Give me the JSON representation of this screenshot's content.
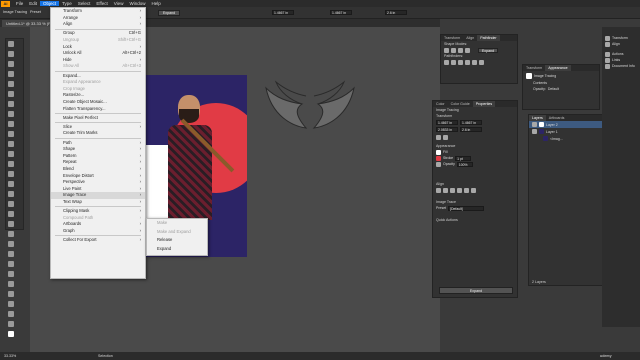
{
  "menubar": {
    "logo": "Ai",
    "items": [
      "File",
      "Edit",
      "Object",
      "Type",
      "Select",
      "Effect",
      "View",
      "Window",
      "Help"
    ],
    "active_index": 2
  },
  "control_bar": {
    "left_label": "Image Tracing",
    "preset": "Preset",
    "expand_button": "Expand"
  },
  "document_tab": {
    "title": "Untitled-1* @ 33.33 % (RGB/P..."
  },
  "object_menu": {
    "items": [
      {
        "label": "Transform",
        "shortcut": "",
        "arrow": true,
        "disabled": false
      },
      {
        "label": "Arrange",
        "shortcut": "",
        "arrow": true,
        "disabled": false
      },
      {
        "label": "Align",
        "shortcut": "",
        "arrow": true,
        "disabled": false
      },
      {
        "sep": true
      },
      {
        "label": "Group",
        "shortcut": "Ctrl+G",
        "disabled": false
      },
      {
        "label": "Ungroup",
        "shortcut": "Shift+Ctrl+G",
        "disabled": true
      },
      {
        "label": "Lock",
        "shortcut": "",
        "arrow": true,
        "disabled": false
      },
      {
        "label": "Unlock All",
        "shortcut": "Alt+Ctrl+2",
        "disabled": false
      },
      {
        "label": "Hide",
        "shortcut": "",
        "arrow": true,
        "disabled": false
      },
      {
        "label": "Show All",
        "shortcut": "Alt+Ctrl+3",
        "disabled": true
      },
      {
        "sep": true
      },
      {
        "label": "Expand...",
        "shortcut": "",
        "disabled": false
      },
      {
        "label": "Expand Appearance",
        "shortcut": "",
        "disabled": true
      },
      {
        "label": "Crop Image",
        "shortcut": "",
        "disabled": true
      },
      {
        "label": "Rasterize...",
        "shortcut": "",
        "disabled": false
      },
      {
        "label": "Create Object Mosaic...",
        "shortcut": "",
        "disabled": false
      },
      {
        "label": "Flatten Transparency...",
        "shortcut": "",
        "disabled": false
      },
      {
        "sep": true
      },
      {
        "label": "Make Pixel Perfect",
        "shortcut": "",
        "disabled": false
      },
      {
        "sep": true
      },
      {
        "label": "Slice",
        "shortcut": "",
        "arrow": true,
        "disabled": false
      },
      {
        "label": "Create Trim Marks",
        "shortcut": "",
        "disabled": false
      },
      {
        "sep": true
      },
      {
        "label": "Path",
        "shortcut": "",
        "arrow": true,
        "disabled": false
      },
      {
        "label": "Shape",
        "shortcut": "",
        "arrow": true,
        "disabled": false
      },
      {
        "label": "Pattern",
        "shortcut": "",
        "arrow": true,
        "disabled": false
      },
      {
        "label": "Repeat",
        "shortcut": "",
        "arrow": true,
        "disabled": false
      },
      {
        "label": "Blend",
        "shortcut": "",
        "arrow": true,
        "disabled": false
      },
      {
        "label": "Envelope Distort",
        "shortcut": "",
        "arrow": true,
        "disabled": false
      },
      {
        "label": "Perspective",
        "shortcut": "",
        "arrow": true,
        "disabled": false
      },
      {
        "label": "Live Paint",
        "shortcut": "",
        "arrow": true,
        "disabled": false
      },
      {
        "label": "Image Trace",
        "shortcut": "",
        "arrow": true,
        "disabled": false,
        "highlight": true
      },
      {
        "label": "Text Wrap",
        "shortcut": "",
        "arrow": true,
        "disabled": false
      },
      {
        "sep": true
      },
      {
        "label": "Clipping Mask",
        "shortcut": "",
        "arrow": true,
        "disabled": false
      },
      {
        "label": "Compound Path",
        "shortcut": "",
        "arrow": true,
        "disabled": true
      },
      {
        "label": "Artboards",
        "shortcut": "",
        "arrow": true,
        "disabled": false
      },
      {
        "label": "Graph",
        "shortcut": "",
        "arrow": true,
        "disabled": false
      },
      {
        "sep": true
      },
      {
        "label": "Collect For Export",
        "shortcut": "",
        "arrow": true,
        "disabled": false
      }
    ]
  },
  "image_trace_submenu": {
    "items": [
      {
        "label": "Make",
        "disabled": true
      },
      {
        "label": "Make and Expand",
        "disabled": true
      },
      {
        "label": "Release",
        "disabled": false
      },
      {
        "label": "Expand",
        "disabled": false
      }
    ]
  },
  "pathfinder_panel": {
    "tabs": [
      "Transform",
      "Align",
      "Pathfinder"
    ],
    "shape_modes": "Shape Modes:",
    "expand": "Expand",
    "pathfinders": "Pathfinders:"
  },
  "properties_panel": {
    "tabs": [
      "Color",
      "Color Guide",
      "Properties"
    ],
    "section_title": "Image Tracing",
    "transform": "Transform",
    "x_value": "1.4667 in",
    "y_value": "2.0833 in",
    "w_value": "1.4667 in",
    "h_value": "2.6 in",
    "appearance": "Appearance",
    "fill": "Fill",
    "stroke": "Stroke",
    "stroke_value": "1 pt",
    "opacity": "Opacity",
    "opacity_value": "100%",
    "align": "Align",
    "image_trace": "Image Trace",
    "preset": "Preset",
    "preset_value": "[Default]",
    "quick_actions": "Quick Actions",
    "expand_button": "Expand"
  },
  "appearance_panel": {
    "tabs": [
      "Transform",
      "Appearance"
    ],
    "title": "Image Tracing",
    "contents": "Contents",
    "opacity": "Opacity:",
    "opacity_value": "Default"
  },
  "layers_panel": {
    "tabs": [
      "Layers",
      "Artboards"
    ],
    "layers": [
      "Layer 2",
      "Layer 1",
      "<Imag..."
    ],
    "footer": "2 Layers"
  },
  "right_dock": {
    "items": [
      "Transform",
      "Align",
      "Actions",
      "Links",
      "Document Info"
    ]
  },
  "status_bar": {
    "zoom": "33.33%",
    "tool": "Selection"
  },
  "watermark": "udemy"
}
